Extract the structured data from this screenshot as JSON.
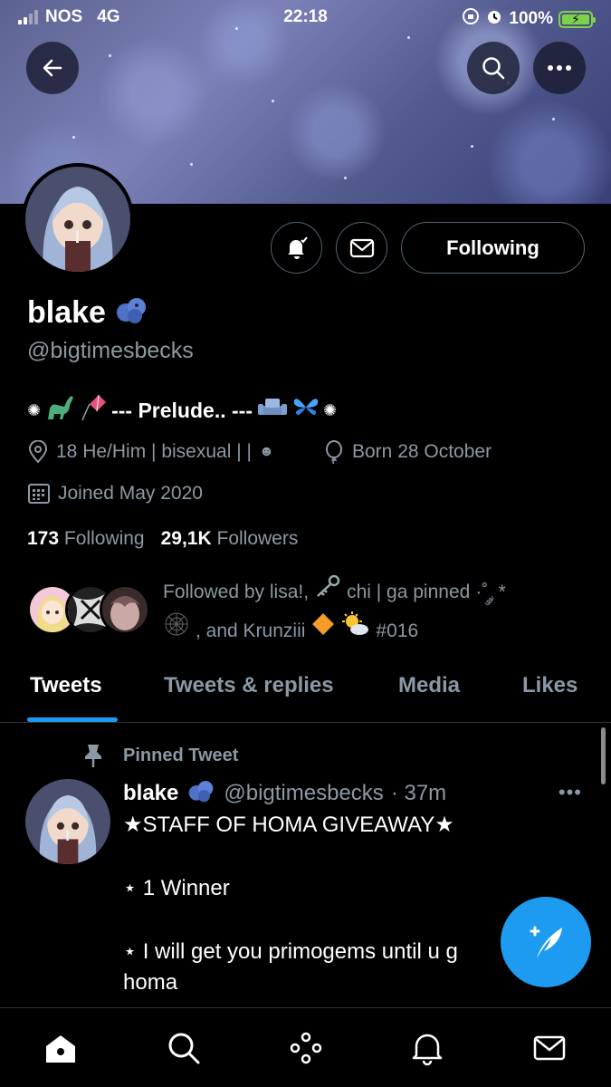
{
  "status_bar": {
    "carrier": "NOS",
    "network": "4G",
    "time": "22:18",
    "battery": "100%"
  },
  "profile": {
    "name": "blake",
    "handle": "@bigtimesbecks",
    "bio": "--- Prelude.. ---",
    "location": "18 He/Him | bisexual | |",
    "birthday": "Born 28 October",
    "joined": "Joined May 2020",
    "following_count": "173",
    "following_label": "Following",
    "followers_count": "29,1K",
    "followers_label": "Followers",
    "followed_by_line1": "Followed by lisa!,",
    "followed_by_name2": "chi | ga pinned",
    "followed_by_line1_tail": "·˚ ༘ *",
    "followed_by_line2_mid": ", and Krunziii",
    "followed_by_tag": "#016",
    "follow_button": "Following"
  },
  "tabs": [
    {
      "label": "Tweets"
    },
    {
      "label": "Tweets & replies"
    },
    {
      "label": "Media"
    },
    {
      "label": "Likes"
    }
  ],
  "tweet": {
    "pinned_label": "Pinned Tweet",
    "name": "blake",
    "handle": "@bigtimesbecks",
    "time": "· 37m",
    "line1": "★STAFF OF HOMA GIVEAWAY★",
    "line2": "⋆ 1 Winner",
    "line3": "⋆ I will get you primogems until u g",
    "line4": "homa"
  },
  "colors": {
    "accent": "#1d9bf0",
    "muted": "#8b98a5",
    "background": "#000000"
  }
}
